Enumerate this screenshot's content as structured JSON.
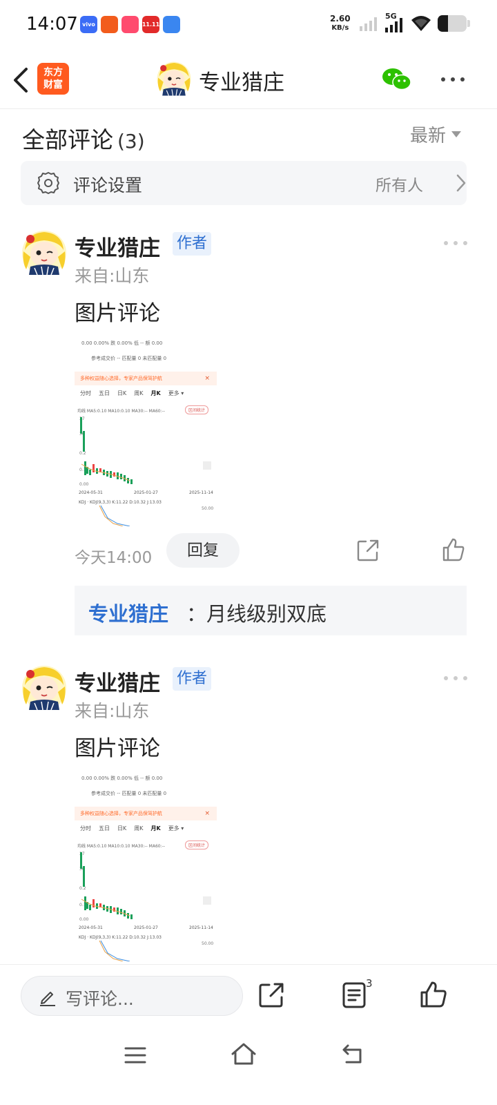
{
  "status_bar": {
    "time": "14:07",
    "net_speed_value": "2.60",
    "net_speed_unit": "KB/s",
    "network": "5G",
    "battery_level": 0.35,
    "app_icons": [
      {
        "name": "vivo-app-icon",
        "color": "#3b6cf6",
        "text": "vivo"
      },
      {
        "name": "paper-plane-app-icon",
        "color": "#f25c1c",
        "text": ""
      },
      {
        "name": "video-app-icon",
        "color": "#ff4b6e",
        "text": ""
      },
      {
        "name": "shopping-app-icon",
        "color": "#e22a2a",
        "text": "11.11"
      },
      {
        "name": "blue-app-icon",
        "color": "#3a86f0",
        "text": ""
      }
    ]
  },
  "header": {
    "logo_line1": "东方",
    "logo_line2": "财富",
    "title": "专业猎庄"
  },
  "comments_section": {
    "title": "全部评论",
    "count": "(3)",
    "sort_label": "最新",
    "settings_label": "评论设置",
    "settings_value": "所有人"
  },
  "comments": [
    {
      "author": "专业猎庄",
      "badge": "作者",
      "location": "来自:山东",
      "text": "图片评论",
      "time": "今天14:00",
      "reply_label": "回复",
      "reply": {
        "author": "专业猎庄",
        "text": "：月线级别双底"
      }
    },
    {
      "author": "专业猎庄",
      "badge": "作者",
      "location": "来自:山东",
      "text": "图片评论"
    }
  ],
  "chart_image": {
    "row1": "0.00  0.00%     跌 0.00%       低 --              额 0.00",
    "row2": "参考成交价  --          匹配量  0          未匹配量  0",
    "banner": "多种权益随心选择，专家产品保驾护航",
    "close": "×",
    "tabs": [
      "分时",
      "五日",
      "日K",
      "周K",
      "月K",
      "更多 ▾"
    ],
    "active_tab": "月K",
    "ma_line": "均线  MA5:0.10  MA10:0.10  MA30:--  MA60:--",
    "interval_button": "区间统计",
    "y_labels": [
      "37",
      "30",
      "0.2",
      "0.1",
      "0.00"
    ],
    "x_labels": [
      "2024-05-31",
      "2025-01-27",
      "2025-11-14"
    ],
    "kdj_line": "KDJ · KDJ(9,3,3)  K:11.22  D:10.32  J:13.03",
    "kdj_level": "50.00"
  },
  "bottom_bar": {
    "write_placeholder": "写评论...",
    "comment_count": "3"
  },
  "colors": {
    "accent_blue": "#2e6fd0",
    "brand_orange": "#ff5a1f",
    "wechat_green": "#2dc100"
  }
}
